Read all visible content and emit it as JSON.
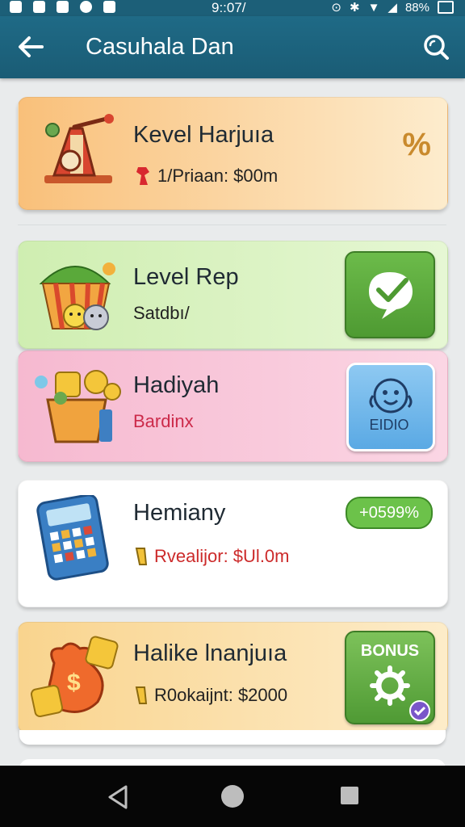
{
  "status_bar": {
    "time": "9::07/",
    "battery_text": "88%"
  },
  "app_bar": {
    "title": "Casuhala Dan"
  },
  "cards": [
    {
      "title": "Kevel Harjuıa",
      "subtitle": "1/Priaan: $00m",
      "badge": "%",
      "colors": {
        "start": "#f9c07a",
        "end": "#fdeccd"
      }
    },
    {
      "title": "Level Rep",
      "subtitle": "Satdbı/",
      "colors": {
        "start": "#cfeeb1",
        "end": "#e6f7d4"
      }
    },
    {
      "title": "Hadiyah",
      "subtitle": "Bardinx",
      "button_label": "EIDIO",
      "colors": {
        "start": "#f6b9d0",
        "end": "#fbd6e4"
      }
    },
    {
      "title": "Hemiany",
      "subtitle": "Rvealijor: $Ul.0m",
      "badge": "+0599%",
      "colors": {
        "start": "#ffffff",
        "end": "#ffffff"
      }
    },
    {
      "title": "Halike lnanjuıa",
      "subtitle": "R0okaijnt: $2000",
      "button_label": "BONUS",
      "colors": {
        "start": "#f9d48e",
        "end": "#fdecc9"
      }
    }
  ]
}
